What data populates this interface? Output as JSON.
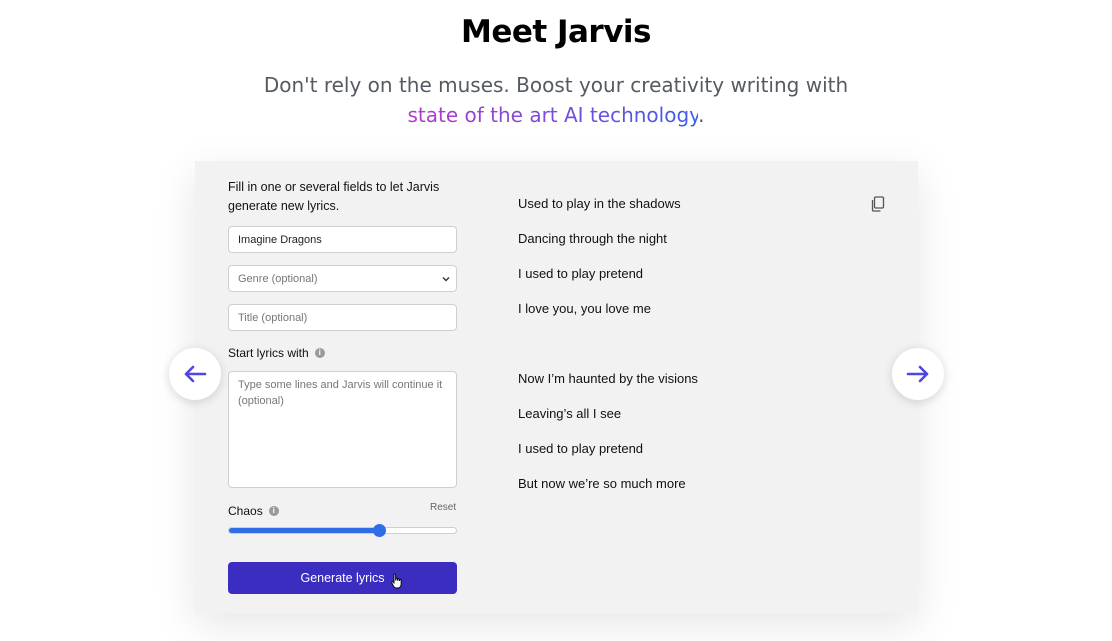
{
  "header": {
    "title": "Meet Jarvis",
    "subtitle_line1": "Don't rely on the muses. Boost your creativity writing with",
    "subtitle_highlight": "state of the art AI technology",
    "subtitle_end": "."
  },
  "form": {
    "instructions": "Fill in one or several fields to let Jarvis generate new lyrics.",
    "artist_value": "Imagine Dragons",
    "genre_placeholder": "Genre (optional)",
    "title_placeholder": "Title (optional)",
    "start_lyrics_label": "Start lyrics with",
    "start_lyrics_placeholder": "Type some lines and Jarvis will continue it (optional)",
    "chaos_label": "Chaos",
    "reset_label": "Reset",
    "chaos_level": 0.66,
    "generate_label": "Generate lyrics",
    "info_icon_glyph": "i"
  },
  "lyrics": [
    "Used to play in the shadows",
    "Dancing through the night",
    "I used to play pretend",
    "I love you, you love me",
    "",
    "Now I’m haunted by the visions",
    "Leaving’s all I see",
    "I used to play pretend",
    "But now we’re so much more"
  ],
  "icons": {
    "prev": "arrow-left-icon",
    "next": "arrow-right-icon",
    "copy": "copy-icon",
    "info": "info-icon"
  },
  "colors": {
    "accent": "#3a2dbf",
    "slider": "#2f6ee6",
    "arrow": "#4f46e5",
    "gradient_start": "#b43ac9",
    "gradient_end": "#3f5ee8"
  }
}
